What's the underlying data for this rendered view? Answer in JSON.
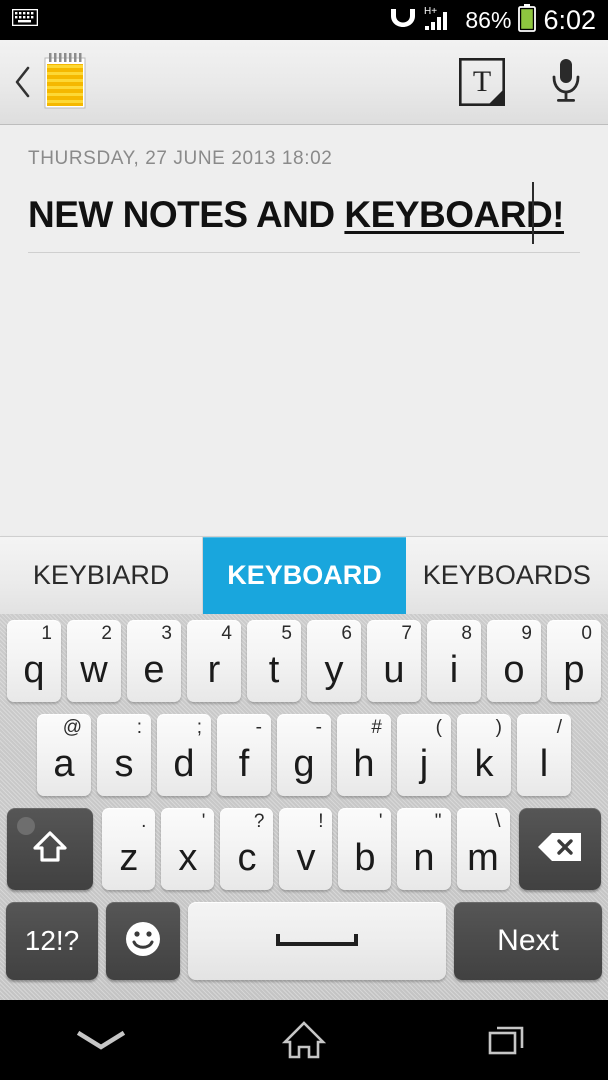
{
  "status_bar": {
    "left_icons": [
      {
        "name": "keyboard-active-icon",
        "glyph": "keyboard"
      }
    ],
    "network_label": "H+",
    "battery_percent": "86%",
    "time": "6:02",
    "background_color": "#000000",
    "text_color": "#ffffff"
  },
  "toolbar": {
    "back_label": "‹",
    "app_icon_name": "notepad-icon",
    "text_format_button_label": "T",
    "voice_button_label": "microphone"
  },
  "note": {
    "date": "THURSDAY, 27 JUNE 2013 18:02",
    "title_plain": "NEW NOTES AND ",
    "title_composing": "KEYBOARD!",
    "caret_visible": true
  },
  "suggestions": {
    "items": [
      {
        "label": "KEYBIARD",
        "selected": false
      },
      {
        "label": "KEYBOARD",
        "selected": true
      },
      {
        "label": "KEYBOARDS",
        "selected": false
      }
    ],
    "selected_color": "#19a6dd"
  },
  "keyboard": {
    "row1": [
      {
        "main": "q",
        "alt": "1"
      },
      {
        "main": "w",
        "alt": "2"
      },
      {
        "main": "e",
        "alt": "3"
      },
      {
        "main": "r",
        "alt": "4"
      },
      {
        "main": "t",
        "alt": "5"
      },
      {
        "main": "y",
        "alt": "6"
      },
      {
        "main": "u",
        "alt": "7"
      },
      {
        "main": "i",
        "alt": "8"
      },
      {
        "main": "o",
        "alt": "9"
      },
      {
        "main": "p",
        "alt": "0"
      }
    ],
    "row2": [
      {
        "main": "a",
        "alt": "@"
      },
      {
        "main": "s",
        "alt": ":"
      },
      {
        "main": "d",
        "alt": ";"
      },
      {
        "main": "f",
        "alt": "-"
      },
      {
        "main": "g",
        "alt": "-"
      },
      {
        "main": "h",
        "alt": "#"
      },
      {
        "main": "j",
        "alt": "("
      },
      {
        "main": "k",
        "alt": ")"
      },
      {
        "main": "l",
        "alt": "/"
      }
    ],
    "row3": [
      {
        "main": "z",
        "alt": "."
      },
      {
        "main": "x",
        "alt": "'"
      },
      {
        "main": "c",
        "alt": "?"
      },
      {
        "main": "v",
        "alt": "!"
      },
      {
        "main": "b",
        "alt": "'"
      },
      {
        "main": "n",
        "alt": "\""
      },
      {
        "main": "m",
        "alt": "\\"
      }
    ],
    "shift_label": "shift",
    "backspace_label": "backspace",
    "symbols_label": "12!?",
    "emoji_label": "emoji",
    "space_label": "space",
    "enter_label": "Next",
    "background_color": "#c8c8c8"
  },
  "navbar": {
    "back_label": "hide-keyboard",
    "home_label": "home",
    "recents_label": "recent-apps"
  }
}
